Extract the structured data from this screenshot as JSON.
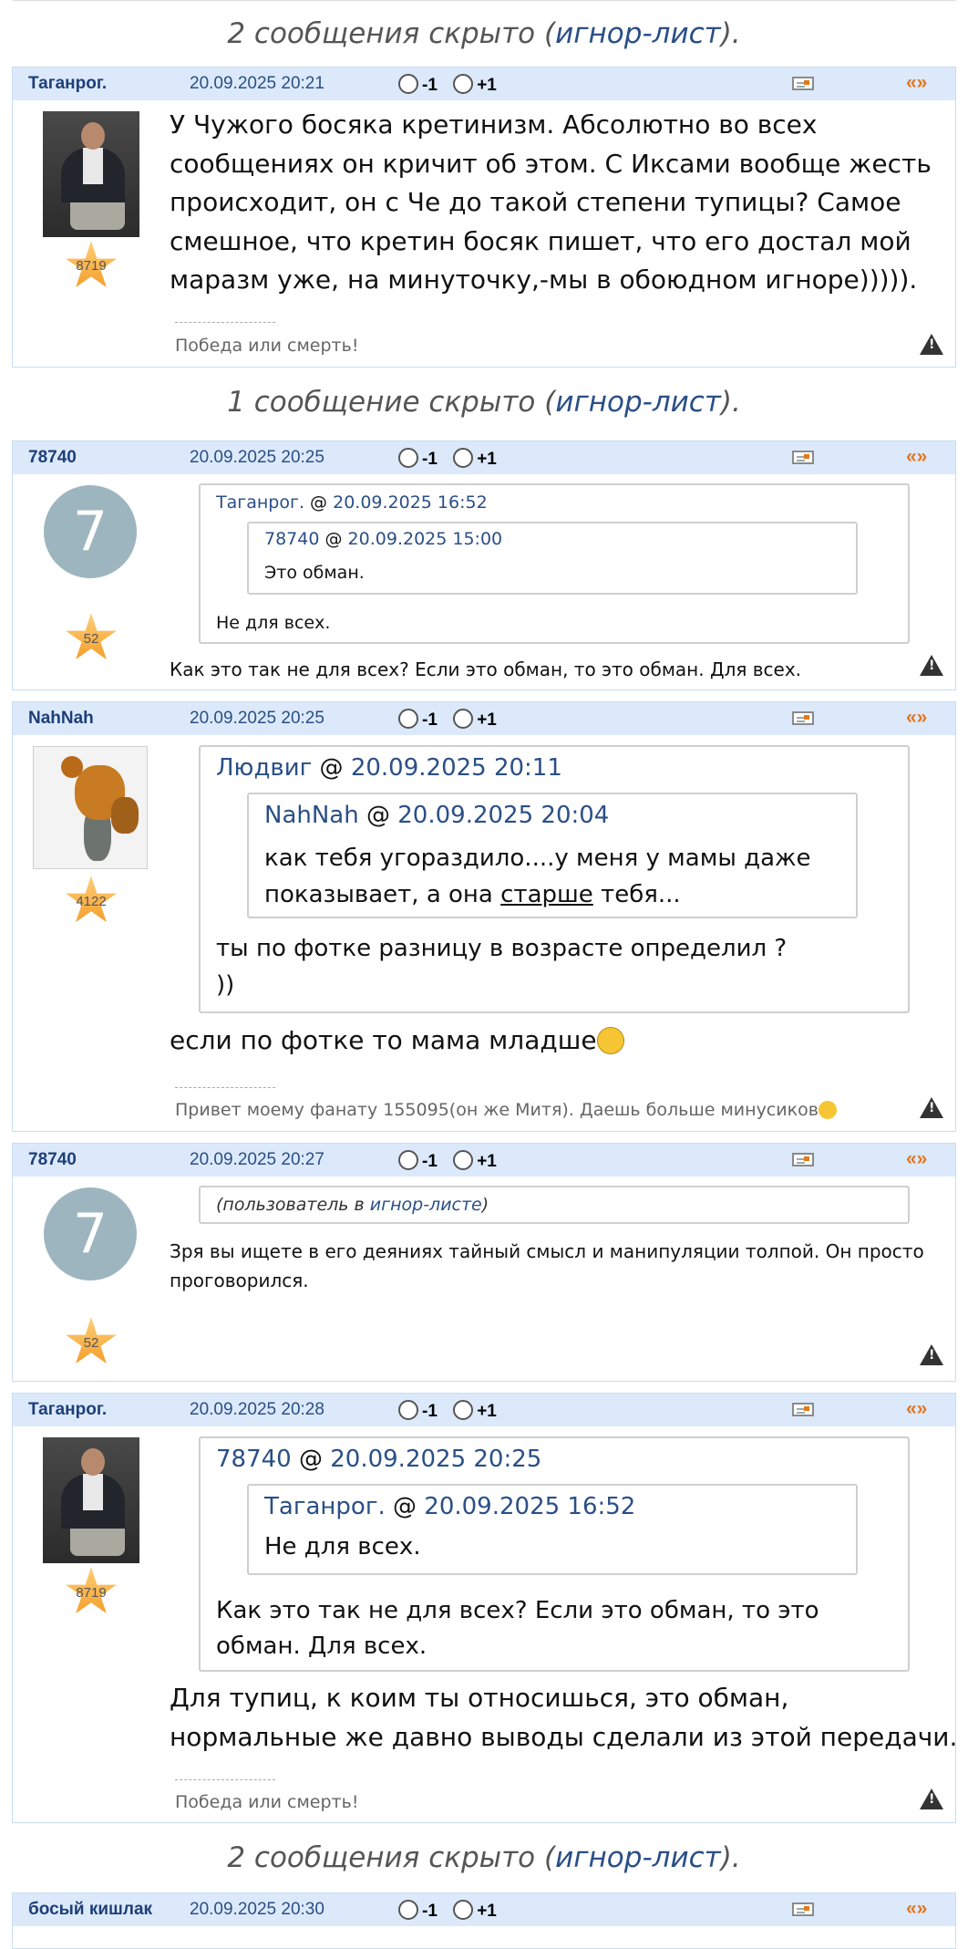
{
  "hidden_notes": [
    {
      "prefix": "2 сообщения скрыто (",
      "link": "игнор-лист",
      "suffix": ")."
    },
    {
      "prefix": "1 сообщение скрыто (",
      "link": "игнор-лист",
      "suffix": ")."
    },
    {
      "prefix": "2 сообщения скрыто (",
      "link": "игнор-лист",
      "suffix": ")."
    }
  ],
  "vote": {
    "minus": "-1",
    "plus": "+1"
  },
  "quote_icon": "«»",
  "posts": [
    {
      "author": "Таганрог.",
      "date": "20.09.2025 20:21",
      "rating": "8719",
      "avatar": "man-photo",
      "text": "У Чужого босяка кретинизм. Абсолютно во всех сообщениях он кричит об этом. С Иксами вообще жесть происходит, он с Че до такой степени тупицы? Самое смешное, что кретин босяк пишет, что его достал мой маразм уже, на минуточку,-мы в обоюдном игноре))))).",
      "signature": "Победа или смерть!"
    },
    {
      "author": "78740",
      "date": "20.09.2025 20:25",
      "rating": "52",
      "avatar_letter": "7",
      "quote": {
        "author": "Таганрог.",
        "date": "20.09.2025 16:52",
        "inner": {
          "author": "78740",
          "date": "20.09.2025 15:00",
          "text": "Это обман."
        },
        "text": "Не для всех."
      },
      "text": "Как это так не для всех? Если это обман, то это обман. Для всех."
    },
    {
      "author": "NahNah",
      "date": "20.09.2025 20:25",
      "rating": "4122",
      "avatar": "bear-photo",
      "quote": {
        "author": "Людвиг",
        "date": "20.09.2025 20:11",
        "inner": {
          "author": "NahNah",
          "date": "20.09.2025 20:04",
          "text_a": "как тебя угораздило....у меня у мамы даже показывает, а она ",
          "text_u": "старше",
          "text_b": " тебя..."
        },
        "text_1": "ты по фотке разницу в возрасте определил ?",
        "text_2": "))"
      },
      "text": "если по фотке то мама младше",
      "signature": "Привет моему фанату 155095(он же Митя). Даешь больше минусиков"
    },
    {
      "author": "78740",
      "date": "20.09.2025 20:27",
      "rating": "52",
      "avatar_letter": "7",
      "ignored": {
        "prefix": "(пользователь в ",
        "link": "игнор-листе",
        "suffix": ")"
      },
      "text": "Зря вы ищете в его деяниях тайный смысл и манипуляции толпой. Он просто проговорился."
    },
    {
      "author": "Таганрог.",
      "date": "20.09.2025 20:28",
      "rating": "8719",
      "avatar": "man-photo",
      "quote": {
        "author": "78740",
        "date": "20.09.2025 20:25",
        "inner": {
          "author": "Таганрог.",
          "date": "20.09.2025 16:52",
          "text": "Не для всех."
        },
        "text": "Как это так не для всех? Если это обман, то это обман. Для всех."
      },
      "text": "Для тупиц, к коим ты относишься, это обман, нормальные же давно выводы сделали из этой передачи.",
      "signature": "Победа или смерть!"
    }
  ],
  "next_post": {
    "author": "босый кишлак",
    "date": "20.09.2025 20:30"
  },
  "colors": {
    "header_bg": "#dce9fb",
    "link": "#2a4f86",
    "author": "#1d3f79",
    "quote_icon": "#e5761c",
    "star": "#f39a24"
  }
}
